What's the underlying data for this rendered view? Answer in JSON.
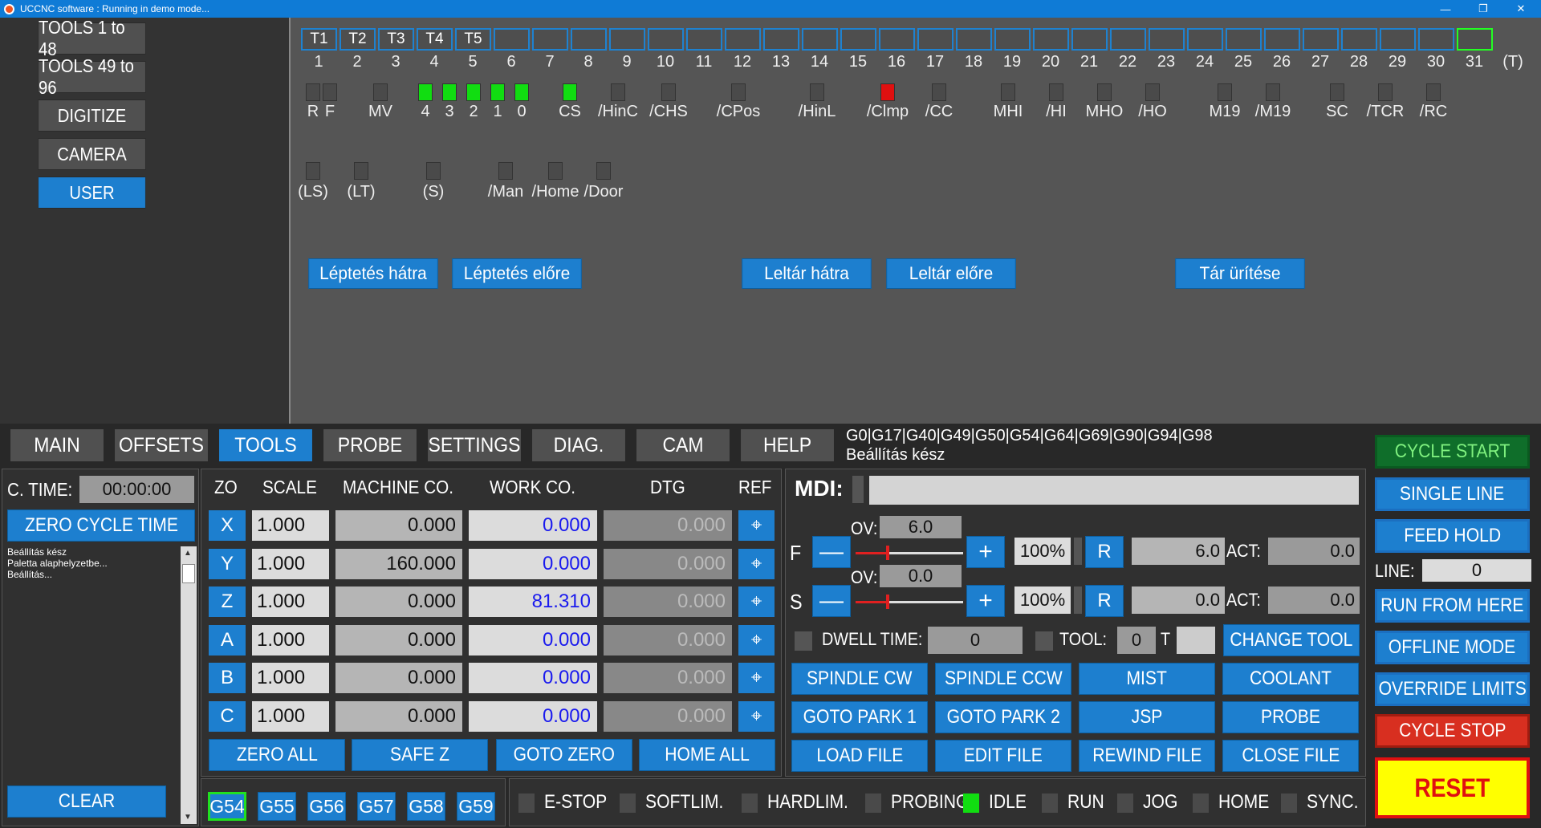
{
  "window": {
    "title": "UCCNC software : Running in demo mode...",
    "min_icon": "minimize-icon",
    "restore_icon": "restore-icon",
    "close_icon": "close-icon"
  },
  "left_menu": [
    "TOOLS 1 to 48",
    "TOOLS 49 to 96",
    "DIGITIZE",
    "CAMERA",
    "USER"
  ],
  "slots": {
    "tool_labels": [
      "T1",
      "T2",
      "T3",
      "T4",
      "T5"
    ],
    "numbers": [
      "1",
      "2",
      "3",
      "4",
      "5",
      "6",
      "7",
      "8",
      "9",
      "10",
      "11",
      "12",
      "13",
      "14",
      "15",
      "16",
      "17",
      "18",
      "19",
      "20",
      "21",
      "22",
      "23",
      "24",
      "25",
      "26",
      "27",
      "28",
      "29",
      "30",
      "31",
      "(T)"
    ],
    "active_slot": 31
  },
  "leds_row1": [
    {
      "label": "R",
      "state": "off"
    },
    {
      "label": "F",
      "state": "off"
    },
    {
      "label": "MV",
      "state": "off"
    },
    {
      "label": "4",
      "state": "on"
    },
    {
      "label": "3",
      "state": "on"
    },
    {
      "label": "2",
      "state": "on"
    },
    {
      "label": "1",
      "state": "on"
    },
    {
      "label": "0",
      "state": "on"
    },
    {
      "label": "CS",
      "state": "on"
    },
    {
      "label": "/HinC",
      "state": "off"
    },
    {
      "label": "/CHS",
      "state": "off"
    },
    {
      "label": "/CPos",
      "state": "off"
    },
    {
      "label": "/HinL",
      "state": "off"
    },
    {
      "label": "/Clmp",
      "state": "red"
    },
    {
      "label": "/CC",
      "state": "off"
    },
    {
      "label": "MHI",
      "state": "off"
    },
    {
      "label": "/HI",
      "state": "off"
    },
    {
      "label": "MHO",
      "state": "off"
    },
    {
      "label": "/HO",
      "state": "off"
    },
    {
      "label": "M19",
      "state": "off"
    },
    {
      "label": "/M19",
      "state": "off"
    },
    {
      "label": "SC",
      "state": "off"
    },
    {
      "label": "/TCR",
      "state": "off"
    },
    {
      "label": "/RC",
      "state": "off"
    }
  ],
  "leds_row2": [
    {
      "label": "(LS)"
    },
    {
      "label": "(LT)"
    },
    {
      "label": "(S)"
    },
    {
      "label": "/Man"
    },
    {
      "label": "/Home"
    },
    {
      "label": "/Door"
    }
  ],
  "tool_buttons": [
    "Léptetés hátra",
    "Léptetés előre",
    "Leltár hátra",
    "Leltár előre",
    "Tár ürítése"
  ],
  "tabs": [
    "MAIN",
    "OFFSETS",
    "TOOLS",
    "PROBE",
    "SETTINGS",
    "DIAG.",
    "CAM",
    "HELP"
  ],
  "active_tab": "TOOLS",
  "gcode_status": "G0|G17|G40|G49|G50|G54|G64|G69|G90|G94|G98",
  "status_message": "Beállítás kész",
  "cycle_time": {
    "label": "C. TIME:",
    "value": "00:00:00",
    "zero_button": "ZERO CYCLE TIME",
    "clear_button": "CLEAR"
  },
  "log_lines": [
    "Beállítás kész",
    "Paletta alaphelyzetbe...",
    "Beállítás..."
  ],
  "axes_headers": [
    "ZO",
    "SCALE",
    "MACHINE CO.",
    "WORK CO.",
    "DTG",
    "REF"
  ],
  "axes": [
    {
      "name": "X",
      "scale": "1.000",
      "machine": "0.000",
      "work": "0.000",
      "dtg": "0.000"
    },
    {
      "name": "Y",
      "scale": "1.000",
      "machine": "160.000",
      "work": "0.000",
      "dtg": "0.000"
    },
    {
      "name": "Z",
      "scale": "1.000",
      "machine": "0.000",
      "work": "81.310",
      "dtg": "0.000"
    },
    {
      "name": "A",
      "scale": "1.000",
      "machine": "0.000",
      "work": "0.000",
      "dtg": "0.000"
    },
    {
      "name": "B",
      "scale": "1.000",
      "machine": "0.000",
      "work": "0.000",
      "dtg": "0.000"
    },
    {
      "name": "C",
      "scale": "1.000",
      "machine": "0.000",
      "work": "0.000",
      "dtg": "0.000"
    }
  ],
  "axis_buttons": [
    "ZERO ALL",
    "SAFE Z",
    "GOTO ZERO",
    "HOME ALL"
  ],
  "wcs": [
    "G54",
    "G55",
    "G56",
    "G57",
    "G58",
    "G59"
  ],
  "active_wcs": "G54",
  "mdi_label": "MDI:",
  "feed": {
    "label": "F",
    "ov_label": "OV:",
    "ov": "6.0",
    "percent": "100%",
    "reset": "R",
    "value": "6.0",
    "act_label": "ACT:",
    "act": "0.0",
    "slider_level": 0.3
  },
  "spindle": {
    "label": "S",
    "ov_label": "OV:",
    "ov": "0.0",
    "percent": "100%",
    "reset": "R",
    "value": "0.0",
    "act_label": "ACT:",
    "act": "0.0",
    "slider_level": 0.3
  },
  "dwell": {
    "label": "DWELL TIME:",
    "value": "0"
  },
  "tool": {
    "label": "TOOL:",
    "value": "0",
    "t_label": "T",
    "change": "CHANGE TOOL"
  },
  "func_buttons": [
    "SPINDLE CW",
    "SPINDLE CCW",
    "MIST",
    "COOLANT",
    "GOTO PARK 1",
    "GOTO PARK 2",
    "JSP",
    "PROBE",
    "LOAD FILE",
    "EDIT FILE",
    "REWIND FILE",
    "CLOSE FILE"
  ],
  "status_leds": [
    {
      "label": "E-STOP",
      "on": false
    },
    {
      "label": "SOFTLIM.",
      "on": false
    },
    {
      "label": "HARDLIM.",
      "on": false
    },
    {
      "label": "PROBING",
      "on": false
    },
    {
      "label": "IDLE",
      "on": true
    },
    {
      "label": "RUN",
      "on": false
    },
    {
      "label": "JOG",
      "on": false
    },
    {
      "label": "HOME",
      "on": false
    },
    {
      "label": "SYNC.",
      "on": false
    }
  ],
  "right_buttons": {
    "cycle_start": "CYCLE START",
    "single_line": "SINGLE LINE",
    "feed_hold": "FEED HOLD",
    "line_label": "LINE:",
    "line_value": "0",
    "run_from_here": "RUN FROM HERE",
    "offline_mode": "OFFLINE MODE",
    "override_limits": "OVERRIDE LIMITS",
    "cycle_stop": "CYCLE STOP",
    "reset": "RESET"
  },
  "colors": {
    "accent": "#1d7fcf",
    "green": "#11dd11",
    "red": "#e01010",
    "reset_bg": "#ffff00"
  }
}
